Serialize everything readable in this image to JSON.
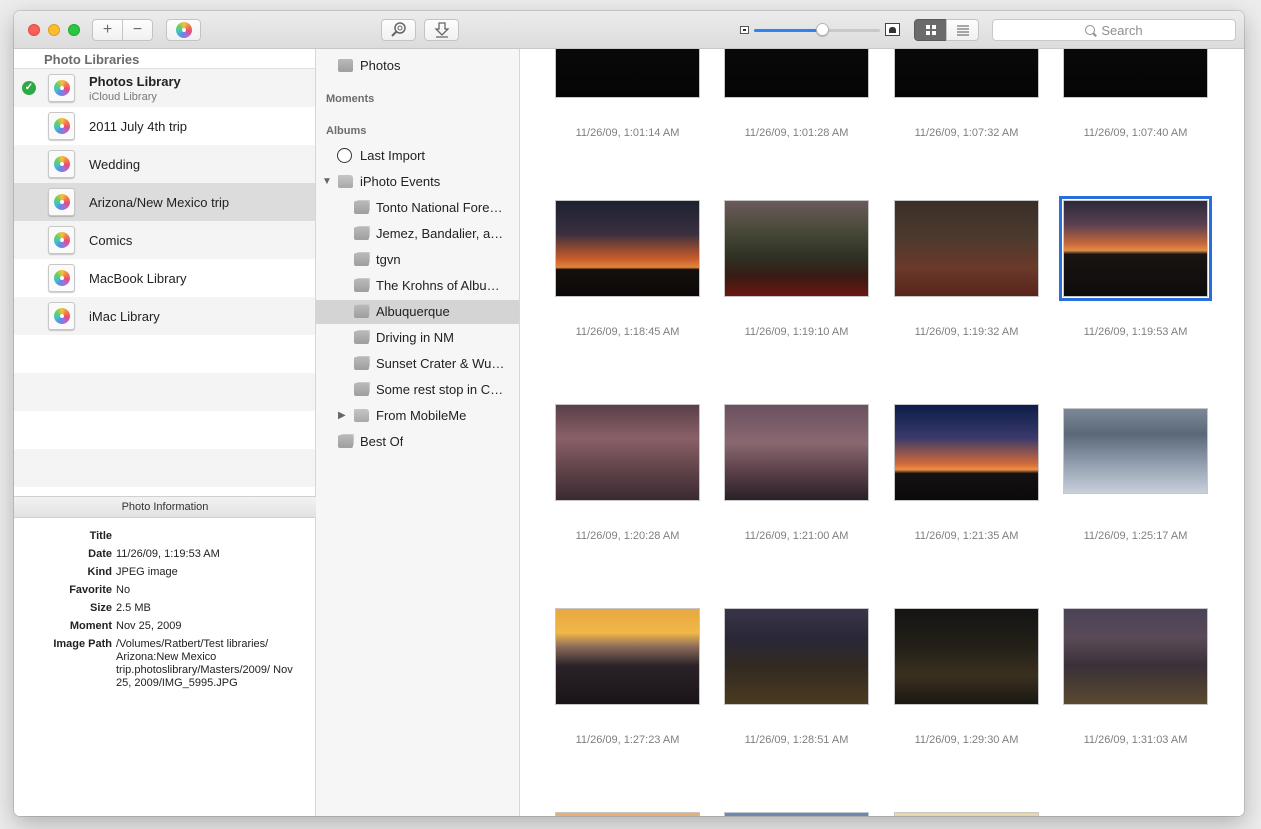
{
  "toolbar": {
    "add_label": "+",
    "remove_label": "−",
    "search_placeholder": "Search",
    "zoom_level": 0.55
  },
  "libraries": {
    "header": "Photo Libraries",
    "items": [
      {
        "name": "Photos Library",
        "subtitle": "iCloud Library",
        "active": true
      },
      {
        "name": "2011 July 4th trip"
      },
      {
        "name": "Wedding"
      },
      {
        "name": "Arizona/New Mexico trip",
        "selected": true
      },
      {
        "name": "Comics"
      },
      {
        "name": "MacBook Library"
      },
      {
        "name": "iMac Library"
      }
    ]
  },
  "photo_info": {
    "header": "Photo Information",
    "rows": [
      {
        "key": "Title",
        "value": ""
      },
      {
        "key": "Date",
        "value": "11/26/09, 1:19:53 AM"
      },
      {
        "key": "Kind",
        "value": "JPEG image"
      },
      {
        "key": "Favorite",
        "value": "No"
      },
      {
        "key": "Size",
        "value": "2.5 MB"
      },
      {
        "key": "Moment",
        "value": "Nov 25, 2009"
      },
      {
        "key": "Image Path",
        "value": "/Volumes/Ratbert/Test libraries/ Arizona:New Mexico trip.photoslibrary/Masters/2009/ Nov 25, 2009/IMG_5995.JPG"
      }
    ]
  },
  "sources": {
    "photos": "Photos",
    "moments_header": "Moments",
    "albums_header": "Albums",
    "last_import": "Last Import",
    "iphoto_events": "iPhoto Events",
    "events": [
      "Tonto National Fore…",
      "Jemez, Bandalier, a…",
      "tgvn",
      "The Krohns of Albu…",
      "Albuquerque",
      "Driving in NM",
      "Sunset Crater & Wu…",
      "Some rest stop in C…"
    ],
    "selected_event_index": 4,
    "from_mobileme": "From MobileMe",
    "best_of": "Best Of"
  },
  "photos": {
    "rows": [
      [
        "11/26/09, 1:01:14 AM",
        "11/26/09, 1:01:28 AM",
        "11/26/09, 1:07:32 AM",
        "11/26/09, 1:07:40 AM"
      ],
      [
        "11/26/09, 1:18:45 AM",
        "11/26/09, 1:19:10 AM",
        "11/26/09, 1:19:32 AM",
        "11/26/09, 1:19:53 AM"
      ],
      [
        "11/26/09, 1:20:28 AM",
        "11/26/09, 1:21:00 AM",
        "11/26/09, 1:21:35 AM",
        "11/26/09, 1:25:17 AM"
      ],
      [
        "11/26/09, 1:27:23 AM",
        "11/26/09, 1:28:51 AM",
        "11/26/09, 1:29:30 AM",
        "11/26/09, 1:31:03 AM"
      ]
    ],
    "selected": [
      1,
      3
    ],
    "accent_color": "#2a6ed9"
  }
}
